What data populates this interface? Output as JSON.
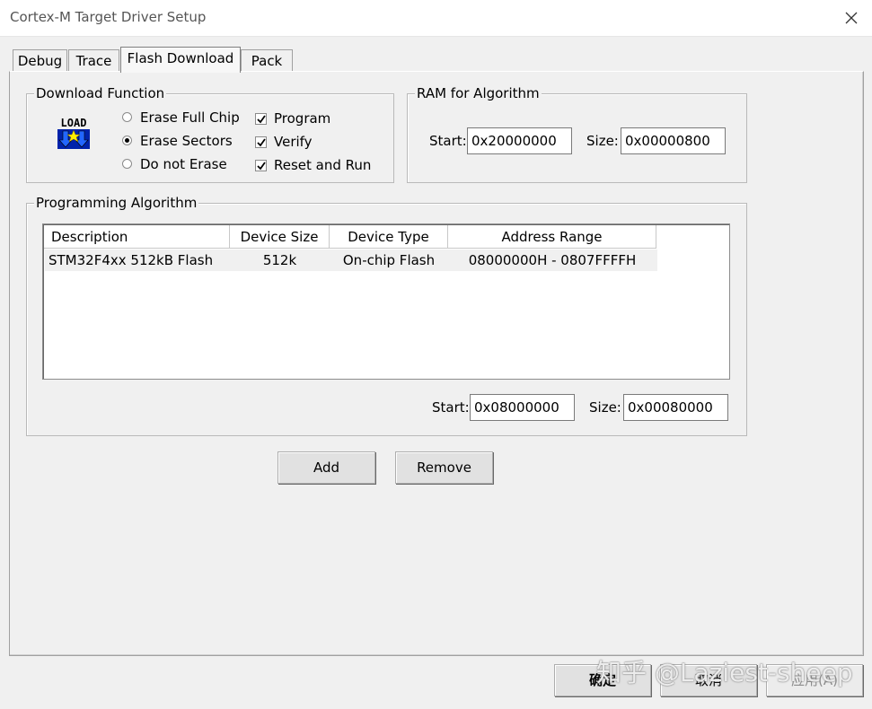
{
  "window": {
    "title": "Cortex-M Target Driver Setup"
  },
  "tabs": [
    {
      "label": "Debug"
    },
    {
      "label": "Trace"
    },
    {
      "label": "Flash Download"
    },
    {
      "label": "Pack"
    }
  ],
  "download_function": {
    "title": "Download Function",
    "icon_text": "LOAD",
    "radios": [
      {
        "label": "Erase Full Chip",
        "selected": false
      },
      {
        "label": "Erase Sectors",
        "selected": true
      },
      {
        "label": "Do not Erase",
        "selected": false
      }
    ],
    "checks": [
      {
        "label": "Program",
        "checked": true
      },
      {
        "label": "Verify",
        "checked": true
      },
      {
        "label": "Reset and Run",
        "checked": true
      }
    ]
  },
  "ram": {
    "title": "RAM for Algorithm",
    "start_label": "Start:",
    "start_value": "0x20000000",
    "size_label": "Size:",
    "size_value": "0x00000800"
  },
  "programming": {
    "title": "Programming Algorithm",
    "columns": [
      "Description",
      "Device Size",
      "Device Type",
      "Address Range"
    ],
    "rows": [
      {
        "description": "STM32F4xx 512kB Flash",
        "size": "512k",
        "type": "On-chip Flash",
        "range": "08000000H - 0807FFFFH"
      }
    ],
    "start_label": "Start:",
    "start_value": "0x08000000",
    "size_label": "Size:",
    "size_value": "0x00080000"
  },
  "buttons": {
    "add": "Add",
    "remove": "Remove",
    "ok": "确定",
    "cancel": "取消",
    "apply": "应用(A)"
  },
  "watermark": "知乎 @Laziest-sheep"
}
